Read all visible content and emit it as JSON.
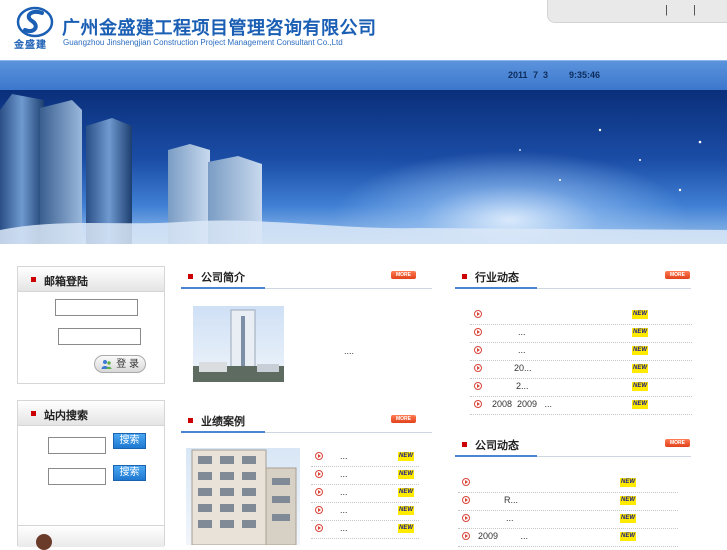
{
  "header": {
    "logo_small": "金盛建",
    "title_cn": "广州金盛建工程项目管理咨询有限公司",
    "title_en": "Guangzhou Jinshengjian Construction Project Management Consultant Co.,Ltd",
    "top_links": [
      "|",
      "|"
    ]
  },
  "datebar": {
    "year": "2011",
    "month": "7",
    "day": "3",
    "time": "9:35:46"
  },
  "login": {
    "title": "邮箱登陆",
    "button": "登 录"
  },
  "search": {
    "title": "站内搜索",
    "button1": "搜索",
    "button2": "搜索"
  },
  "about": {
    "title": "公司简介",
    "more": "MORE",
    "excerpt": "...."
  },
  "cases": {
    "title": "业绩案例",
    "more": "MORE",
    "items": [
      "...",
      "...",
      "...",
      "...",
      "..."
    ]
  },
  "industry": {
    "title": "行业动态",
    "more": "MORE",
    "items": [
      "",
      "...",
      "...",
      "20...",
      "2...",
      "2008  2009   ..."
    ]
  },
  "company": {
    "title": "公司动态",
    "more": "MORE",
    "items": [
      "",
      "R...",
      "...",
      "2009         ..."
    ]
  },
  "badge": "NEW",
  "colors": {
    "brand": "#1b5fb5",
    "datebar": "#4a85d6",
    "accent_red": "#cc0000"
  }
}
